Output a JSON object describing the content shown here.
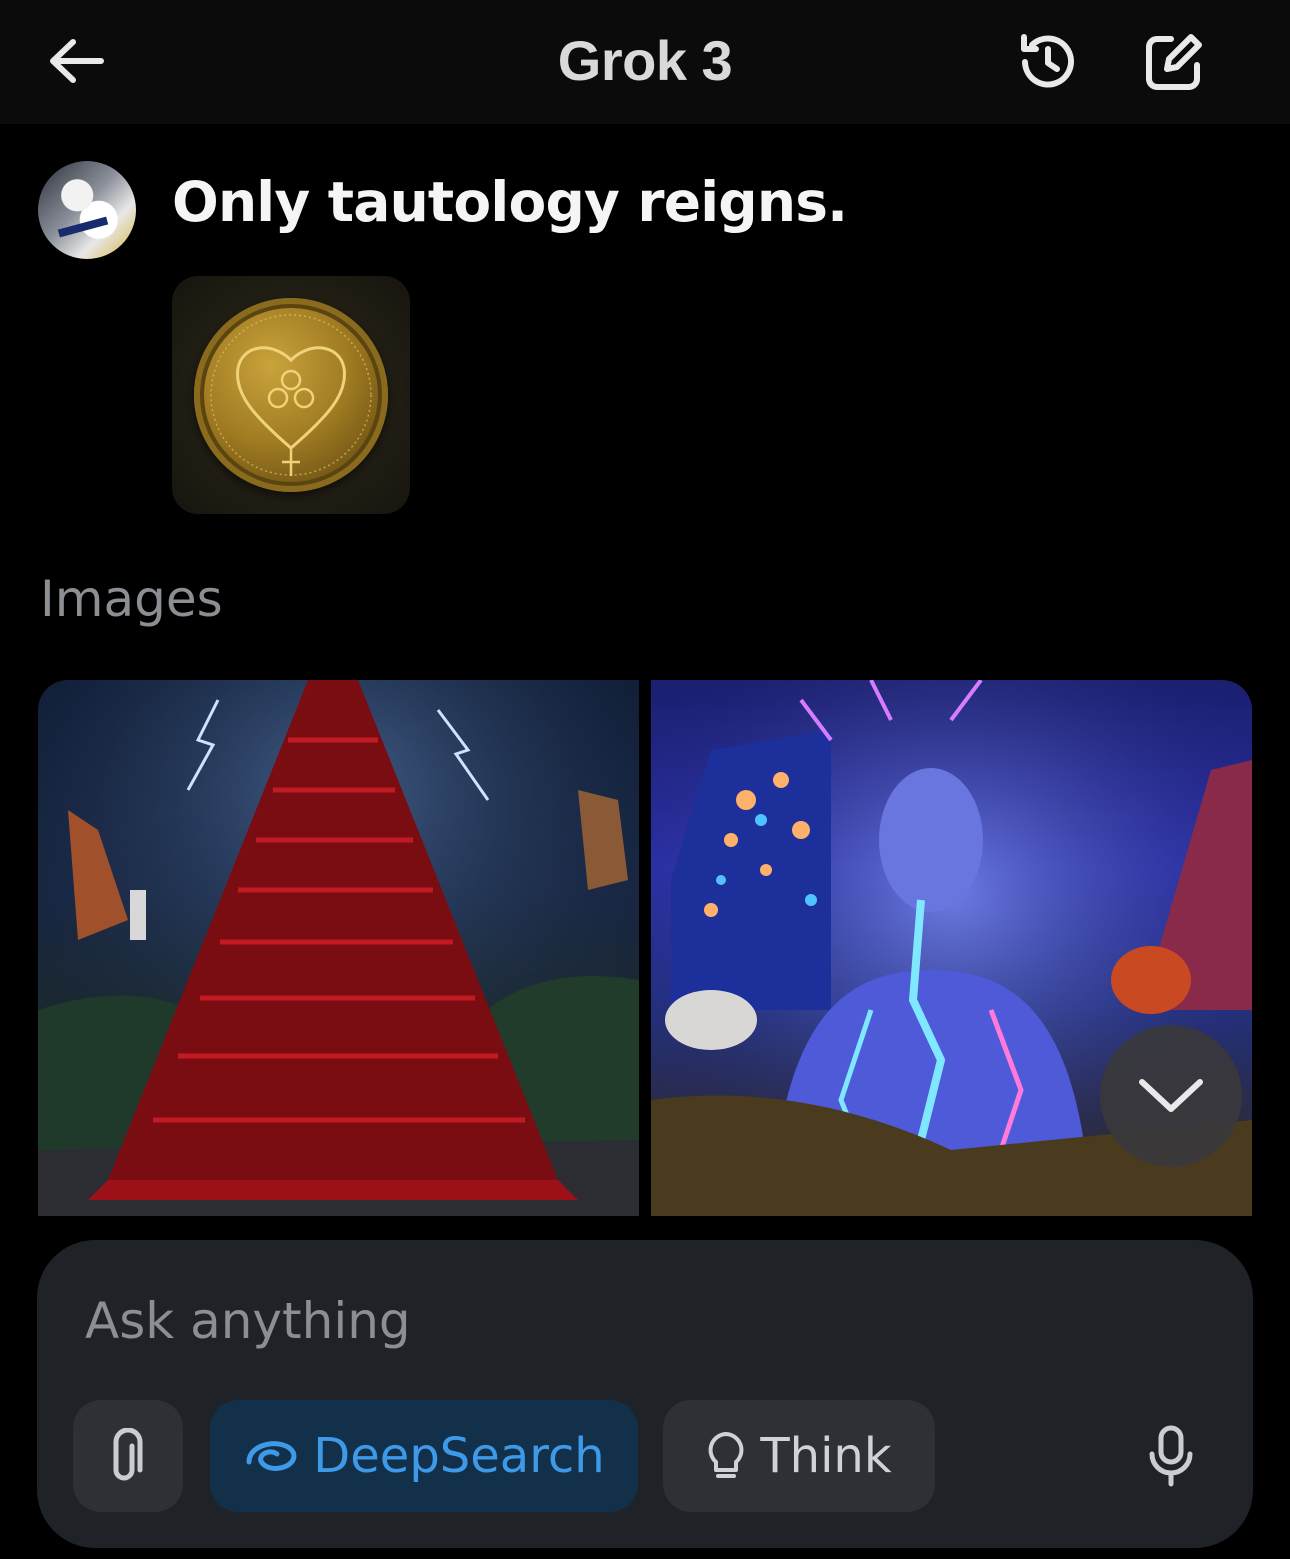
{
  "header": {
    "title": "Grok 3",
    "back_icon": "arrow-left-icon",
    "history_icon": "history-icon",
    "compose_icon": "compose-icon"
  },
  "conversation": {
    "user_message": "Only tautology reigns.",
    "attachment_description": "gold-coin-heart-triskele-image"
  },
  "images_section": {
    "label": "Images",
    "items": [
      {
        "name": "red-tower-image"
      },
      {
        "name": "electric-figure-image"
      }
    ]
  },
  "composer": {
    "placeholder": "Ask anything",
    "attach_icon": "paperclip-icon",
    "deepsearch_label": "DeepSearch",
    "think_label": "Think",
    "mic_icon": "microphone-icon"
  },
  "colors": {
    "background": "#000000",
    "composer_bg": "#1f2226",
    "accent_blue": "#3e9ae8",
    "deepsearch_bg": "#123049"
  }
}
